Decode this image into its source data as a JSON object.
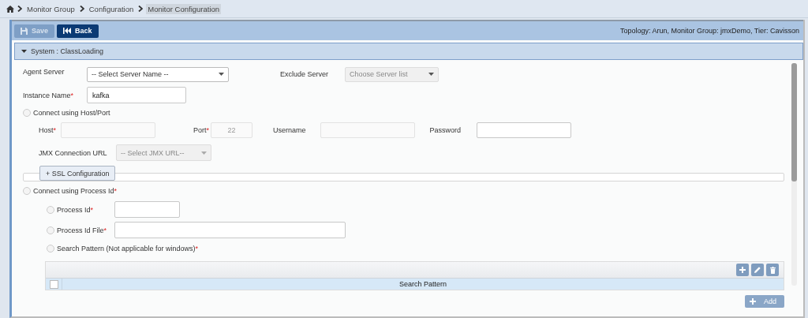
{
  "breadcrumb": [
    {
      "label": "Monitor Group",
      "selected": false
    },
    {
      "label": "Configuration",
      "selected": false
    },
    {
      "label": "Monitor Configuration",
      "selected": true
    }
  ],
  "toolbar": {
    "buttons": [
      {
        "label": "Save",
        "kind": "save",
        "disabled": true
      },
      {
        "label": "Back",
        "kind": "back",
        "disabled": false
      }
    ],
    "context": "Topology: Arun, Monitor Group: jmxDemo, Tier: Cavisson"
  },
  "section": {
    "title": "System : ClassLoading",
    "expanded": true
  },
  "form": {
    "agent_server": {
      "label": "Agent Server",
      "value": "-- Select Server Name --"
    },
    "exclude_server": {
      "label": "Exclude Server",
      "value": "Choose Server list",
      "disabled": true
    },
    "instance_name": {
      "label": "Instance Name",
      "required_mark": "*",
      "value": "kafka"
    },
    "host_port": {
      "label": "Connect using Host/Port",
      "selected": false,
      "fields": [
        {
          "label": "Host",
          "required_mark": "*",
          "disabled": true
        },
        {
          "label": "Port",
          "required_mark": "*",
          "value": "22",
          "disabled": true
        },
        {
          "label": "Username",
          "disabled": true
        },
        {
          "label": "Password",
          "disabled": false
        }
      ],
      "jmx_url": {
        "label": "JMX Connection URL",
        "value": "-- Select JMX URL--",
        "disabled": true
      },
      "ssl_button": "+ SSL Configuration"
    },
    "process": {
      "label": "Connect using Process Id",
      "required_mark": "*",
      "selected": false,
      "options": [
        {
          "label": "Process Id",
          "required_mark": "*",
          "selected": false,
          "kind": "input"
        },
        {
          "label": "Process Id File",
          "required_mark": "*",
          "selected": false,
          "kind": "input"
        },
        {
          "label": "Search Pattern (Not applicable for windows)",
          "required_mark": "*",
          "selected": false,
          "kind": "none"
        }
      ]
    },
    "table": {
      "columns": [
        "Search Pattern"
      ],
      "select_all": {
        "checked": false
      }
    },
    "add_button": "Add"
  }
}
